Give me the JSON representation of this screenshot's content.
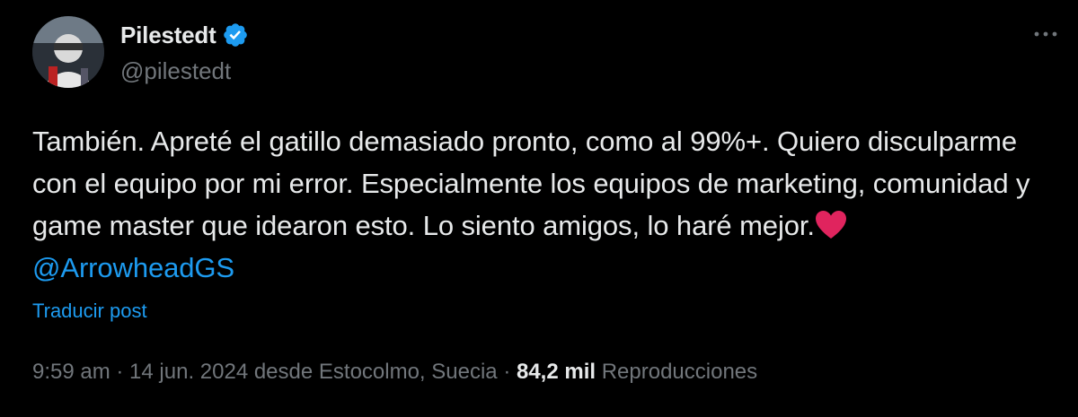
{
  "author": {
    "display_name": "Pilestedt",
    "handle": "@pilestedt",
    "verified": true,
    "avatar_icon": "avatar-photo"
  },
  "post": {
    "text": "También. Apreté el gatillo demasiado pronto, como al 99%+. Quiero disculparme con el equipo por mi error. Especialmente los equipos de marketing, comunidad y game master que idearon esto. Lo siento amigos, lo haré mejor.",
    "emoji": "red-heart-icon",
    "mention": "@ArrowheadGS",
    "translate_label": "Traducir post"
  },
  "meta": {
    "time": "9:59 am",
    "sep1": " · ",
    "date_location": "14 jun. 2024 desde Estocolmo, Suecia",
    "sep2": " · ",
    "views_count": "84,2 mil",
    "views_label": " Reproducciones"
  },
  "colors": {
    "background": "#000000",
    "text": "#e7e9ea",
    "muted": "#71767b",
    "link": "#1d9bf0",
    "heart": "#e0245e"
  }
}
